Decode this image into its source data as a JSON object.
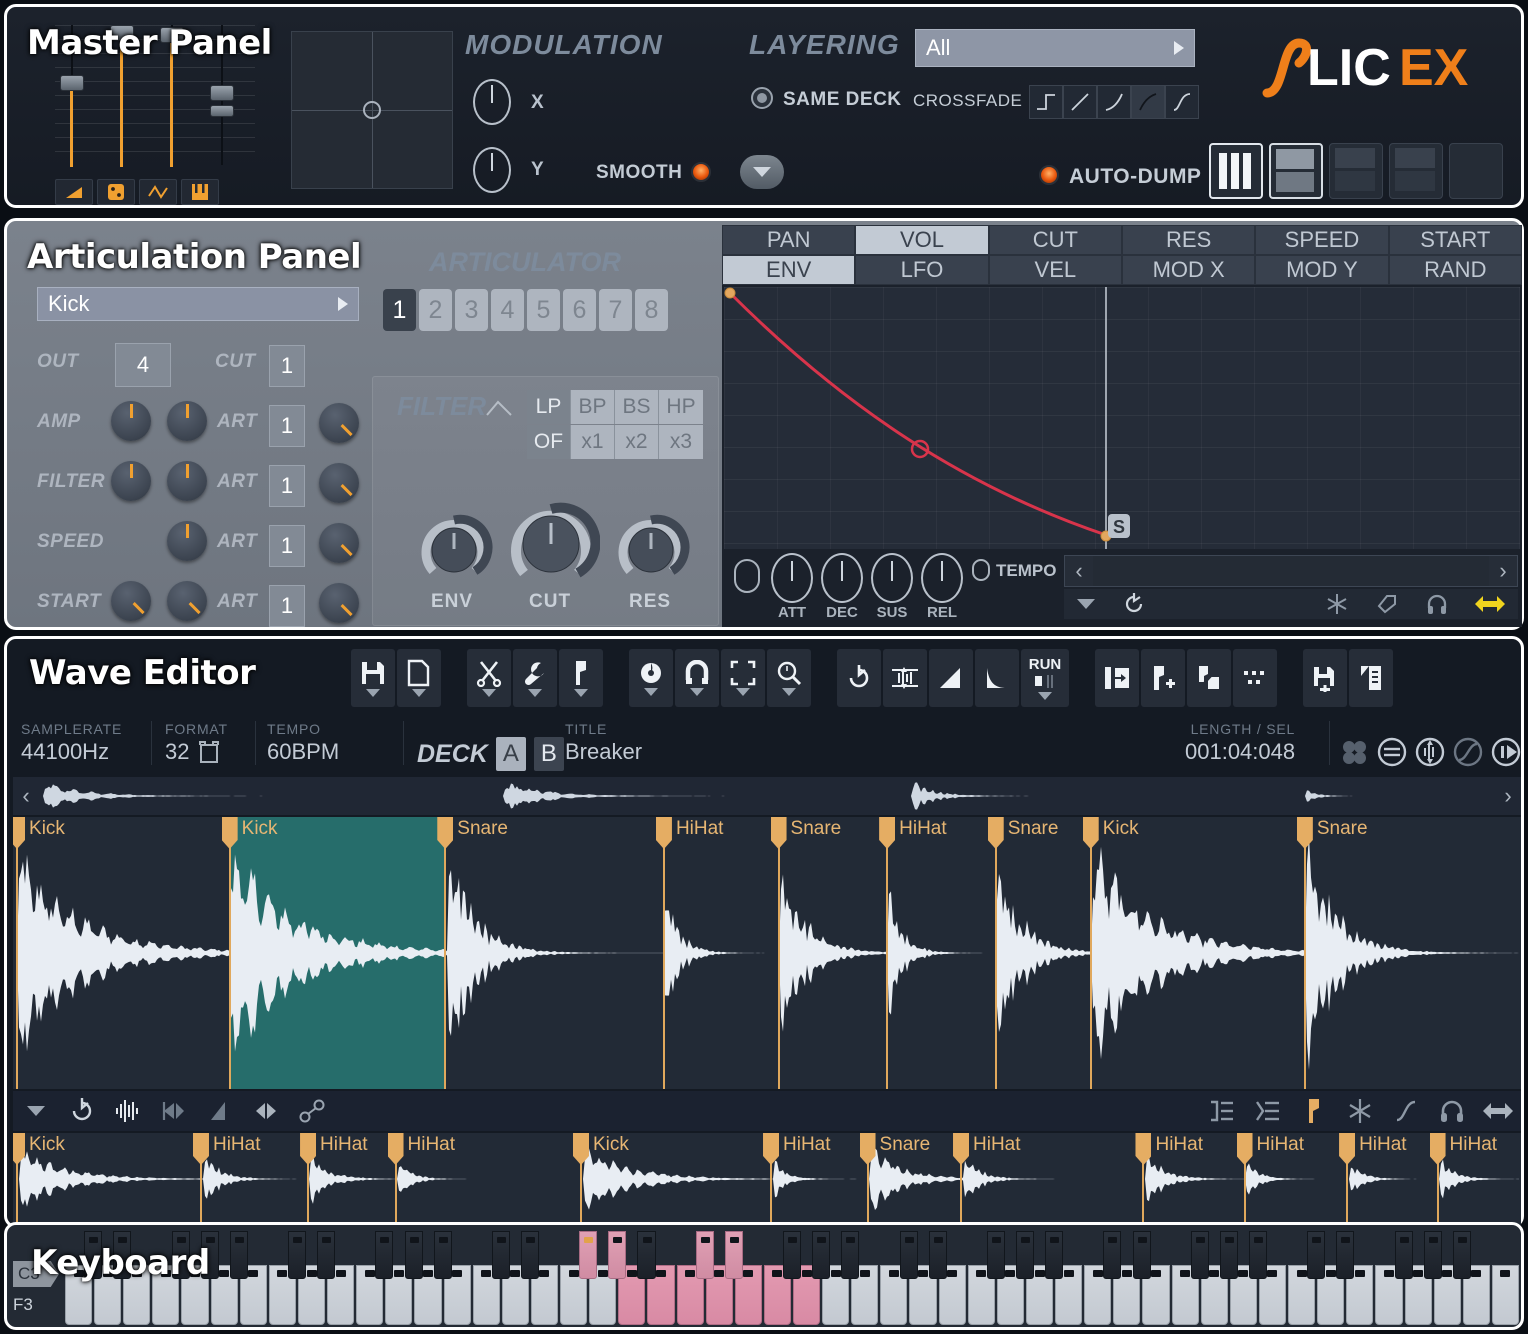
{
  "master_panel": {
    "title": "Master Panel",
    "modulation": {
      "label": "MODULATION",
      "x_label": "X",
      "y_label": "Y",
      "smooth_label": "SMOOTH"
    },
    "mini_buttons": [
      {
        "name": "ramp-icon"
      },
      {
        "name": "dice-icon"
      },
      {
        "name": "wave-icon"
      },
      {
        "name": "keyboard-icon"
      }
    ],
    "layering": {
      "label": "LAYERING",
      "mode_value": "All",
      "same_deck_label": "SAME DECK",
      "crossfade_label": "CROSSFADE",
      "crossfade_shapes": [
        "step",
        "linear",
        "slow-start",
        "fast-start",
        "s-curve"
      ],
      "crossfade_selected_index": 3,
      "auto_dump_label": "AUTO-DUMP"
    },
    "logo": {
      "text_a": "LIC",
      "text_b": "EX"
    }
  },
  "articulation_panel": {
    "title": "Articulation Panel",
    "slice_value": "Kick",
    "rows": [
      {
        "label": "OUT",
        "value": "4"
      },
      {
        "label": "AMP",
        "art_label": "ART",
        "art_value": "1"
      },
      {
        "label": "FILTER",
        "art_label": "ART",
        "art_value": "1"
      },
      {
        "label": "SPEED",
        "art_label": "ART",
        "art_value": "1"
      },
      {
        "label": "START",
        "art_label": "ART",
        "art_value": "1"
      }
    ],
    "cut_label": "CUT",
    "cut_value": "1",
    "articulator": {
      "label": "ARTICULATOR",
      "numbers": [
        "1",
        "2",
        "3",
        "4",
        "5",
        "6",
        "7",
        "8"
      ],
      "selected": "1"
    },
    "filter": {
      "label": "FILTER",
      "types": [
        "LP",
        "BP",
        "BS",
        "HP"
      ],
      "type_selected": "LP",
      "orders": [
        "OF",
        "x1",
        "x2",
        "x3"
      ],
      "order_selected": "OF",
      "knobs": [
        "ENV",
        "CUT",
        "RES"
      ]
    }
  },
  "env_editor": {
    "tabs_row1": [
      "PAN",
      "VOL",
      "CUT",
      "RES",
      "SPEED",
      "START"
    ],
    "tabs_row2": [
      "ENV",
      "LFO",
      "VEL",
      "MOD X",
      "MOD Y",
      "RAND"
    ],
    "selected_row1": "VOL",
    "selected_row2": "ENV",
    "knobs": [
      "ATT",
      "DEC",
      "SUS",
      "REL"
    ],
    "tempo_label": "TEMPO",
    "sustain_marker": "S",
    "curve_color": "#d8344b"
  },
  "wave_editor": {
    "title": "Wave Editor",
    "toolbar_groups": [
      {
        "buttons": [
          {
            "name": "save-icon",
            "caret": true
          },
          {
            "name": "new-file-icon",
            "caret": true
          }
        ]
      },
      {
        "buttons": [
          {
            "name": "scissors-icon",
            "caret": true
          },
          {
            "name": "wrench-icon",
            "caret": true
          },
          {
            "name": "marker-icon",
            "caret": true
          }
        ]
      },
      {
        "buttons": [
          {
            "name": "phase-icon",
            "caret": true
          },
          {
            "name": "magnet-icon",
            "caret": true
          },
          {
            "name": "select-icon",
            "caret": true
          },
          {
            "name": "zoom-icon",
            "caret": true
          }
        ]
      },
      {
        "buttons": [
          {
            "name": "reverse-icon",
            "caret": false
          },
          {
            "name": "normalize-icon",
            "caret": false
          },
          {
            "name": "fade-in-icon",
            "caret": false
          },
          {
            "name": "fade-out-icon",
            "caret": false
          },
          {
            "name": "run-icon",
            "caret": true,
            "label": "RUN"
          }
        ]
      },
      {
        "buttons": [
          {
            "name": "slice-to-marker-icon",
            "caret": false
          },
          {
            "name": "add-marker-icon",
            "caret": false
          },
          {
            "name": "delete-marker-icon",
            "caret": false
          },
          {
            "name": "dither-icon",
            "caret": false
          }
        ]
      },
      {
        "buttons": [
          {
            "name": "save-as-icon",
            "caret": false
          },
          {
            "name": "export-icon",
            "caret": false
          }
        ]
      }
    ],
    "info": {
      "samplerate_label": "SAMPLERATE",
      "samplerate_value": "44100Hz",
      "format_label": "FORMAT",
      "format_value": "32",
      "tempo_label": "TEMPO",
      "tempo_value": "60BPM",
      "deck_label": "DECK",
      "deck_a": "A",
      "deck_b": "B",
      "deck_selected": "A",
      "title_label": "TITLE",
      "title_value": "Breaker",
      "length_label": "LENGTH / SEL",
      "length_value": "001:04:048"
    },
    "right_icons": [
      "four-dots-icon",
      "equalize-icon",
      "normalize-circle-icon",
      "slope-circle-icon",
      "play-half-icon"
    ],
    "top_markers": [
      {
        "label": "Kick",
        "x_pct": 0.2
      },
      {
        "label": "Kick",
        "x_pct": 14.3
      },
      {
        "label": "Snare",
        "x_pct": 28.6
      },
      {
        "label": "HiHat",
        "x_pct": 43.1
      },
      {
        "label": "Snare",
        "x_pct": 50.7
      },
      {
        "label": "HiHat",
        "x_pct": 57.9
      },
      {
        "label": "Snare",
        "x_pct": 65.1
      },
      {
        "label": "Kick",
        "x_pct": 71.4
      },
      {
        "label": "Snare",
        "x_pct": 85.6
      }
    ],
    "selection": {
      "start_pct": 14.3,
      "end_pct": 28.6
    },
    "mid_toolbar_left": [
      "caret-down-icon",
      "reload-icon",
      "waveform-icon",
      "fit-left-icon",
      "fade-icon",
      "fit-right-icon",
      "link-icon"
    ],
    "mid_toolbar_right": [
      "align-right-icon",
      "align-list-icon",
      "marker-flag-icon",
      "snowflake-icon",
      "curve-icon",
      "headphone-icon",
      "resize-icon"
    ],
    "bottom_markers": [
      {
        "label": "Kick",
        "x_pct": 0.2
      },
      {
        "label": "HiHat",
        "x_pct": 12.4
      },
      {
        "label": "HiHat",
        "x_pct": 19.5
      },
      {
        "label": "HiHat",
        "x_pct": 25.3
      },
      {
        "label": "Kick",
        "x_pct": 37.6
      },
      {
        "label": "HiHat",
        "x_pct": 50.2
      },
      {
        "label": "Snare",
        "x_pct": 56.6
      },
      {
        "label": "HiHat",
        "x_pct": 62.8
      },
      {
        "label": "HiHat",
        "x_pct": 74.9
      },
      {
        "label": "HiHat",
        "x_pct": 81.6
      },
      {
        "label": "HiHat",
        "x_pct": 88.4
      },
      {
        "label": "HiHat",
        "x_pct": 94.4
      }
    ]
  },
  "keyboard": {
    "title": "Keyboard",
    "octave_label_top": "C3",
    "octave_label_bottom": "F3",
    "white_key_count": 50,
    "highlighted_white_keys": [
      19,
      20,
      21,
      22,
      23,
      24,
      25
    ],
    "highlighted_black_keys": [
      12,
      13,
      15,
      16
    ]
  },
  "colors": {
    "accent_orange": "#f0a030",
    "marker_orange": "#e5ad63",
    "selection_teal": "#2c9a8e",
    "env_curve_red": "#d8344b",
    "key_pink": "#d88aa4",
    "panel_blue": "#1b212b"
  }
}
